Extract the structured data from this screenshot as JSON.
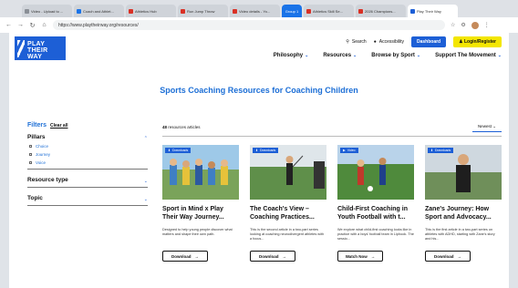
{
  "browser": {
    "tabs": [
      {
        "label": "Video - Upload to ...",
        "color": "#8a8f96"
      },
      {
        "label": "Coach and Athlet...",
        "color": "#1a73e8"
      },
      {
        "label": "Athletics Hub",
        "color": "#d93025"
      },
      {
        "label": "Run Jump Throw",
        "color": "#d93025"
      },
      {
        "label": "Video details - Yo...",
        "color": "#d93025"
      },
      {
        "label": "Group 1",
        "color": "#1a73e8"
      },
      {
        "label": "Athletics Skill Se...",
        "color": "#d93025"
      },
      {
        "label": "2026 Champions...",
        "color": "#d93025"
      },
      {
        "label": "Play Their Way",
        "color": "#1d5fd6"
      }
    ],
    "url": "https://www.playtheirway.org/resources/"
  },
  "header": {
    "logo": [
      "PLAY",
      "THEIR",
      "WAY"
    ],
    "search": "Search",
    "accessibility": "Accessibility",
    "dashboard": "Dashboard",
    "login": "Login/Register",
    "menu": [
      "Philosophy",
      "Resources",
      "Browse by Sport",
      "Support The Movement"
    ]
  },
  "hero": {
    "title": "Sports Coaching Resources for Coaching Children"
  },
  "filters": {
    "title": "Filters",
    "clear": "Clear all",
    "pillars_title": "Pillars",
    "pillars": [
      "Choice",
      "Journey",
      "Voice"
    ],
    "resource_type": "Resource type",
    "topic": "Topic"
  },
  "results": {
    "count": "48",
    "count_suffix": "resources articles",
    "sort": "Newest",
    "cards": [
      {
        "badge": "Downloads",
        "title": "Sport in Mind x Play Their Way Journey...",
        "desc": "Designed to help young people discover what matters and shape their own path.",
        "button": "Download"
      },
      {
        "badge": "Downloads",
        "title": "The Coach's View – Coaching Practices...",
        "desc": "This is the second article in a two-part series looking at coaching neurodivergent athletes with a focus...",
        "button": "Download"
      },
      {
        "badge": "Video",
        "title": "Child-First Coaching in Youth Football with t...",
        "desc": "We explore what child-first coaching looks like in practice with a boys' football team in Liphook. The sessio...",
        "button": "Watch Now"
      },
      {
        "badge": "Downloads",
        "title": "Zane's Journey: How Sport and Advocacy...",
        "desc": "This is the first article in a two-part series on athletes with ADHD, starting with Zane's story and his...",
        "button": "Download"
      }
    ]
  }
}
